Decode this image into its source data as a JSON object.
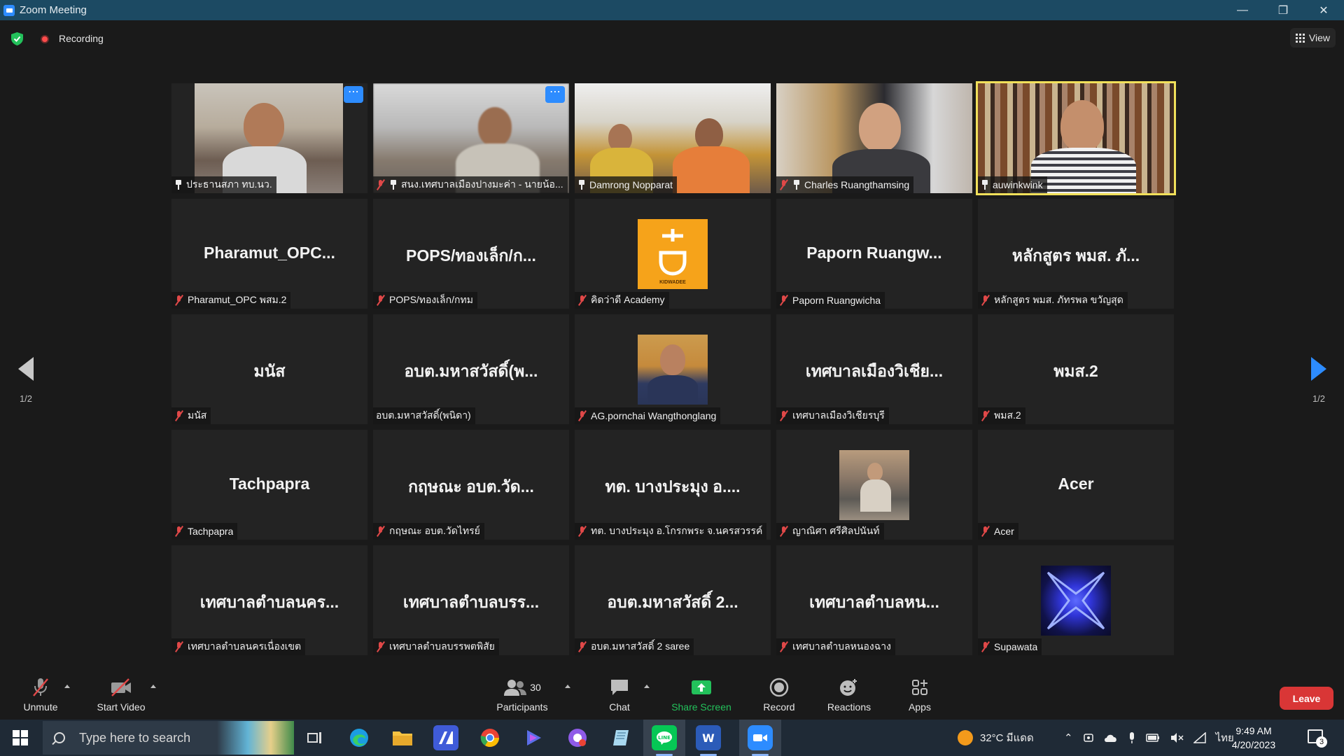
{
  "window": {
    "title": "Zoom Meeting"
  },
  "meeting": {
    "recording_label": "Recording",
    "view_label": "View"
  },
  "pager": {
    "left_page": "1/2",
    "right_page": "1/2"
  },
  "tiles": [
    {
      "big": "",
      "label": "ประธานสภา ทบ.นว.",
      "video": true
    },
    {
      "big": "",
      "label": "สนง.เทศบาลเมืองปางมะค่า - นายน้อ...",
      "video": true
    },
    {
      "big": "",
      "label": "Damrong Nopparat",
      "video": true
    },
    {
      "big": "",
      "label": "Charles Ruangthamsing",
      "video": true
    },
    {
      "big": "",
      "label": "auwinkwink",
      "video": true
    },
    {
      "big": "Pharamut_OPC...",
      "label": "Pharamut_OPC พสม.2"
    },
    {
      "big": "POPS/ทองเล็ก/ก...",
      "label": "POPS/ทองเล็ก/กทม"
    },
    {
      "big": "",
      "label": "คิดว่าดี Academy",
      "avatar": "kidwadee"
    },
    {
      "big": "Paporn Ruangw...",
      "label": "Paporn Ruangwicha"
    },
    {
      "big": "หลักสูตร พมส. ภั...",
      "label": "หลักสูตร พมส. ภัทรพล ขวัญสุด"
    },
    {
      "big": "มนัส",
      "label": "มนัส"
    },
    {
      "big": "อบต.มหาสวัสดิ์(พ...",
      "label": "อบต.มหาสวัสดิ์(พนิดา)"
    },
    {
      "big": "",
      "label": "AG.pornchai Wangthonglang",
      "avatar": "ag"
    },
    {
      "big": "เทศบาลเมืองวิเชีย...",
      "label": "เทศบาลเมืองวิเชียรบุรี"
    },
    {
      "big": "พมส.2",
      "label": "พมส.2"
    },
    {
      "big": "Tachpapra",
      "label": "Tachpapra"
    },
    {
      "big": "กฤษณะ  อบต.วัด...",
      "label": "กฤษณะ  อบต.วัดไทรย์"
    },
    {
      "big": "ทต. บางประมุง อ....",
      "label": "ทต. บางประมุง อ.โกรกพระ จ.นครสวรรค์"
    },
    {
      "big": "",
      "label": "ญาณิศา ศรีศิลปนันท์",
      "avatar": "photo"
    },
    {
      "big": "Acer",
      "label": "Acer"
    },
    {
      "big": "เทศบาลตำบลนคร...",
      "label": "เทศบาลตำบลนครเนื่องเขต"
    },
    {
      "big": "เทศบาลตำบลบรร...",
      "label": "เทศบาลตำบลบรรพตพิสัย"
    },
    {
      "big": "อบต.มหาสวัสดิ์ 2...",
      "label": "อบต.มหาสวัสดิ์ 2 saree"
    },
    {
      "big": "เทศบาลตำบลหน...",
      "label": "เทศบาลตำบลหนองฉาง"
    },
    {
      "big": "",
      "label": "Supawata",
      "avatar": "neon"
    }
  ],
  "kidwadee_text": "KIDWADEE",
  "controls": {
    "unmute": "Unmute",
    "start_video": "Start Video",
    "participants": "Participants",
    "participant_count": "30",
    "chat": "Chat",
    "share_screen": "Share Screen",
    "record": "Record",
    "reactions": "Reactions",
    "apps": "Apps",
    "leave": "Leave"
  },
  "taskbar": {
    "search_placeholder": "Type here to search",
    "weather": "32°C  มีแดด",
    "language": "ไทย",
    "time": "9:49 AM",
    "date": "4/20/2023",
    "notifications": "3"
  },
  "colors": {
    "accent": "#2d8cff",
    "leave": "#d93636",
    "share": "#23c15b",
    "active_speaker": "#f1e05a",
    "mic_muted": "#e04848"
  }
}
